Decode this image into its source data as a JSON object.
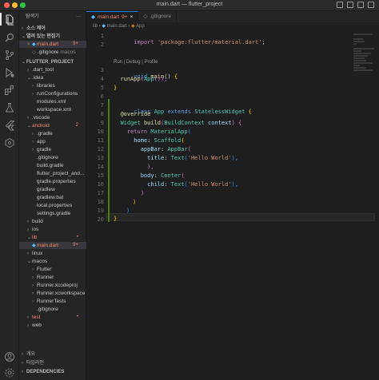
{
  "window": {
    "title": "main.dart — flutter_project"
  },
  "colors": {
    "accent": "#0a84ff",
    "modified": "#f48771",
    "close": "#ff5f57",
    "minimize": "#febc2e",
    "zoom": "#28c840"
  },
  "sidebar": {
    "header": "탐색기",
    "header_more": "···",
    "source_control": "소스 제어",
    "open_editors_header": "열려 있는 편집기",
    "open_editors": [
      {
        "label": "main.dart",
        "extra": "lib",
        "badge": "9+"
      },
      {
        "label": ".gitignore",
        "extra": "macos"
      }
    ],
    "project_header": "FLUTTER_PROJECT",
    "tree": [
      {
        "label": ".dart_tool",
        "chev": "›"
      },
      {
        "label": ".idea",
        "chev": "⌄"
      },
      {
        "label": "libraries",
        "chev": "›"
      },
      {
        "label": "runConfigurations",
        "chev": "›"
      },
      {
        "label": "modules.xml"
      },
      {
        "label": "workspace.xml"
      },
      {
        "label": ".vscode",
        "chev": "›"
      },
      {
        "label": "android",
        "chev": "⌄",
        "badge": "2"
      },
      {
        "label": ".gradle",
        "chev": "›"
      },
      {
        "label": "app",
        "chev": "›"
      },
      {
        "label": "gradle",
        "chev": "›"
      },
      {
        "label": ".gitignore"
      },
      {
        "label": "build.gradle"
      },
      {
        "label": "flutter_project_and..."
      },
      {
        "label": "gradle.properties"
      },
      {
        "label": "gradlew"
      },
      {
        "label": "gradlew.bat"
      },
      {
        "label": "local.properties"
      },
      {
        "label": "settings.gradle"
      },
      {
        "label": "build",
        "chev": "›"
      },
      {
        "label": "ios",
        "chev": "›"
      },
      {
        "label": "lib",
        "chev": "⌄",
        "badge": "•"
      },
      {
        "label": "main.dart",
        "badge": "9+"
      },
      {
        "label": "linux",
        "chev": "›"
      },
      {
        "label": "macos",
        "chev": "⌄"
      },
      {
        "label": "Flutter",
        "chev": "›"
      },
      {
        "label": "Runner",
        "chev": "›"
      },
      {
        "label": "Runner.xcodeproj",
        "chev": "›"
      },
      {
        "label": "Runner.xcworkspace",
        "chev": "›"
      },
      {
        "label": "RunnerTests",
        "chev": "›"
      },
      {
        "label": ".gitignore"
      },
      {
        "label": "test",
        "chev": "›",
        "badge": "•"
      },
      {
        "label": "web",
        "chev": "›"
      }
    ],
    "outline": "개요",
    "timeline": "타임라인",
    "dependencies": "DEPENDENCIES"
  },
  "editor": {
    "tabs": [
      {
        "label": "main.dart",
        "badge": "9+",
        "active": true
      },
      {
        "label": ".gitignore",
        "active": false
      }
    ],
    "breadcrumbs": [
      "lib",
      "main.dart",
      "App"
    ],
    "codelens": "Run | Debug | Profile",
    "line_numbers": [
      "1",
      "2",
      "3",
      "4",
      "5",
      "6",
      "7",
      "8",
      "9",
      "10",
      "11",
      "12",
      "13",
      "14",
      "15",
      "16",
      "17",
      "18",
      "19",
      "20",
      "21"
    ]
  },
  "code": {
    "l1_kw": "import",
    "l1_str": "'package:flutter/material.dart'",
    "l1_end": ";",
    "l3_kw": "void",
    "l3_fn": "main",
    "l3_rest": "() ",
    "l3_br": "{",
    "l4_fn": "runApp",
    "l4_p1": "(",
    "l4_cls": "App",
    "l4_p2": "());",
    "l5": "}",
    "l7_kw": "class",
    "l7_cls": "App",
    "l7_kw2": "extends",
    "l7_cls2": "StatelessWidget",
    "l7_br": "{",
    "l8": "@override",
    "l9_cls": "Widget",
    "l9_fn": "build",
    "l9_p": "(",
    "l9_cls2": "BuildContext",
    "l9_var": "context",
    "l9_end": ") {",
    "l10_kw": "return",
    "l10_cls": "MaterialApp",
    "l10_p": "(",
    "l11_prop": "home",
    "l11_cls": "Scaffold",
    "l11_p": "(",
    "l12_prop": "appBar",
    "l12_cls": "AppBar",
    "l12_p": "(",
    "l13_prop": "title",
    "l13_cls": "Text",
    "l13_str": "'Hello World'",
    "l13_end": "),",
    "l14": "),",
    "l15_prop": "body",
    "l15_cls": "Center",
    "l15_p": "(",
    "l16_prop": "child",
    "l16_cls": "Text",
    "l16_str": "'Hello World'",
    "l16_end": "),",
    "l17": ")",
    "l18": ")",
    "l19": ")",
    "l20": "}",
    "l21": "}"
  }
}
